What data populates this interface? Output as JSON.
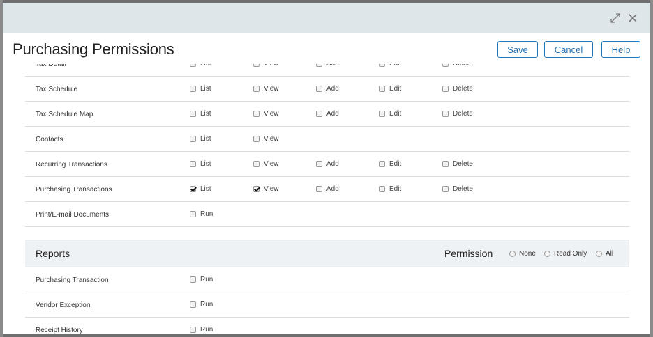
{
  "header": {
    "title": "Purchasing Permissions",
    "save_label": "Save",
    "cancel_label": "Cancel",
    "help_label": "Help"
  },
  "window_icons": [
    "expand-icon",
    "close-icon"
  ],
  "permissions": {
    "rows": [
      {
        "label": "Tax Detail",
        "options": [
          {
            "label": "List",
            "checked": false
          },
          {
            "label": "View",
            "checked": false
          },
          {
            "label": "Add",
            "checked": false
          },
          {
            "label": "Edit",
            "checked": false
          },
          {
            "label": "Delete",
            "checked": false
          }
        ]
      },
      {
        "label": "Tax Schedule",
        "options": [
          {
            "label": "List",
            "checked": false
          },
          {
            "label": "View",
            "checked": false
          },
          {
            "label": "Add",
            "checked": false
          },
          {
            "label": "Edit",
            "checked": false
          },
          {
            "label": "Delete",
            "checked": false
          }
        ]
      },
      {
        "label": "Tax Schedule Map",
        "options": [
          {
            "label": "List",
            "checked": false
          },
          {
            "label": "View",
            "checked": false
          },
          {
            "label": "Add",
            "checked": false
          },
          {
            "label": "Edit",
            "checked": false
          },
          {
            "label": "Delete",
            "checked": false
          }
        ]
      },
      {
        "label": "Contacts",
        "options": [
          {
            "label": "List",
            "checked": false
          },
          {
            "label": "View",
            "checked": false
          }
        ]
      },
      {
        "label": "Recurring Transactions",
        "options": [
          {
            "label": "List",
            "checked": false
          },
          {
            "label": "View",
            "checked": false
          },
          {
            "label": "Add",
            "checked": false
          },
          {
            "label": "Edit",
            "checked": false
          },
          {
            "label": "Delete",
            "checked": false
          }
        ]
      },
      {
        "label": "Purchasing Transactions",
        "options": [
          {
            "label": "List",
            "checked": true
          },
          {
            "label": "View",
            "checked": true
          },
          {
            "label": "Add",
            "checked": false
          },
          {
            "label": "Edit",
            "checked": false
          },
          {
            "label": "Delete",
            "checked": false
          }
        ]
      },
      {
        "label": "Print/E-mail Documents",
        "options": [
          {
            "label": "Run",
            "checked": false
          }
        ]
      }
    ]
  },
  "reports": {
    "title": "Reports",
    "permission_label": "Permission",
    "radio_options": [
      {
        "label": "None",
        "selected": false
      },
      {
        "label": "Read Only",
        "selected": false
      },
      {
        "label": "All",
        "selected": false
      }
    ],
    "rows": [
      {
        "label": "Purchasing Transaction",
        "options": [
          {
            "label": "Run",
            "checked": false
          }
        ]
      },
      {
        "label": "Vendor Exception",
        "options": [
          {
            "label": "Run",
            "checked": false
          }
        ]
      },
      {
        "label": "Receipt History",
        "options": [
          {
            "label": "Run",
            "checked": false
          }
        ]
      }
    ]
  }
}
